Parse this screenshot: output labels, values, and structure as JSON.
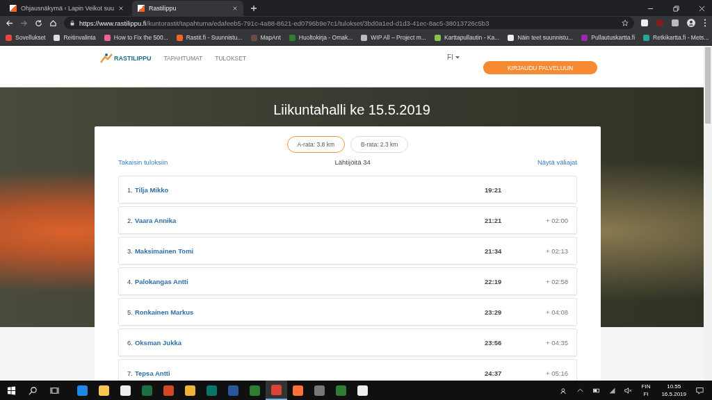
{
  "browser": {
    "tabs": [
      {
        "title": "Ohjausnäkymä ‹ Lapin Veikot suu",
        "selected": false
      },
      {
        "title": "Rastilippu",
        "selected": true
      }
    ],
    "url": {
      "host": "https://www.rastilippu.fi",
      "path": "/kuntorastit/tapahtuma/edafeeb5-791c-4a88-8621-ed0796b9e7c1/tulokset/3bd0a1ed-d1d3-41ec-8ac5-38013726c5b3"
    },
    "bookmarks": [
      {
        "label": "Sovellukset",
        "color": "#e8453c"
      },
      {
        "label": "Reitinvalinta",
        "color": "#dddddd"
      },
      {
        "label": "How to Fix the 500...",
        "color": "#f06292"
      },
      {
        "label": "Rastit.fi - Suunnistu...",
        "color": "#f26522"
      },
      {
        "label": "MapAnt",
        "color": "#6d4c41"
      },
      {
        "label": "Huoltokirja - Omak...",
        "color": "#2e7d32"
      },
      {
        "label": "WIP All – Project m...",
        "color": "#bbbbbb"
      },
      {
        "label": "Karttapullautin - Ka...",
        "color": "#8bc34a"
      },
      {
        "label": "Näin teet suunnistu...",
        "color": "#eeeeee"
      },
      {
        "label": "Pullautuskartta.fi",
        "color": "#9c27b0"
      },
      {
        "label": "Retkikartta.fi - Mets...",
        "color": "#26a69a"
      }
    ]
  },
  "site": {
    "logo": "RASTILIPPU",
    "nav": [
      "TAPAHTUMAT",
      "TULOKSET"
    ],
    "language": "FI",
    "login_button": "KIRJAUDU PALVELUUN"
  },
  "event": {
    "title": "Liikuntahalli ke 15.5.2019",
    "courses": [
      {
        "label": "A-rata: 3.8 km",
        "selected": true
      },
      {
        "label": "B-rata: 2.3 km",
        "selected": false
      }
    ],
    "back_link": "Takaisin tuloksiin",
    "starters": "Lähtijöitä 34",
    "splits_link": "Näytä väliajat",
    "results": [
      {
        "rank": "1.",
        "name": "Tilja Mikko",
        "time": "19:21"
      },
      {
        "rank": "2.",
        "name": "Vaara Annika",
        "time": "21:21",
        "diff": "+ 02:00"
      },
      {
        "rank": "3.",
        "name": "Maksimainen Tomi",
        "time": "21:34",
        "diff": "+ 02:13"
      },
      {
        "rank": "4.",
        "name": "Palokangas Antti",
        "time": "22:19",
        "diff": "+ 02:58"
      },
      {
        "rank": "5.",
        "name": "Ronkainen Markus",
        "time": "23:29",
        "diff": "+ 04:08"
      },
      {
        "rank": "6.",
        "name": "Oksman Jukka",
        "time": "23:56",
        "diff": "+ 04:35"
      },
      {
        "rank": "7.",
        "name": "Tepsa Antti",
        "time": "24:37",
        "diff": "+ 05:16"
      }
    ]
  },
  "taskbar": {
    "apps": [
      {
        "color": "#1e88e5",
        "selected": false
      },
      {
        "color": "#f9c74f",
        "selected": false
      },
      {
        "color": "#eeeeee",
        "selected": false
      },
      {
        "color": "#1d6f42",
        "selected": false
      },
      {
        "color": "#d24726",
        "selected": false
      },
      {
        "color": "#f0b43c",
        "selected": false
      },
      {
        "color": "#077568",
        "selected": false
      },
      {
        "color": "#2b579a",
        "selected": false
      },
      {
        "color": "#2e7d32",
        "selected": false
      },
      {
        "color": "#db4437",
        "selected": true
      },
      {
        "color": "#ff7139",
        "selected": false
      },
      {
        "color": "#777777",
        "selected": false
      },
      {
        "color": "#2e7d32",
        "selected": false
      },
      {
        "color": "#eeeeee",
        "selected": false
      }
    ],
    "language": [
      "FIN",
      "FI"
    ],
    "time": "10.55",
    "date": "16.5.2019"
  }
}
